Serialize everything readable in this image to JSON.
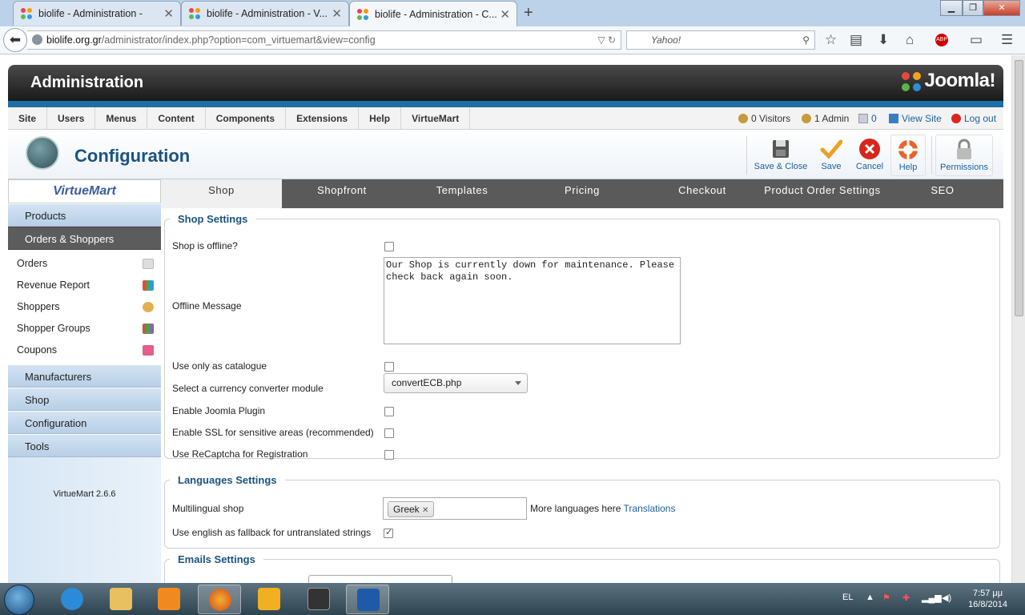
{
  "browser": {
    "tabs": [
      {
        "title": "biolife - Administration -"
      },
      {
        "title": "biolife - Administration - V..."
      },
      {
        "title": "biolife - Administration - C..."
      }
    ],
    "url_host": "biolife.org.gr",
    "url_path": "/administrator/index.php?option=com_virtuemart&view=config",
    "search_placeholder": "Yahoo!",
    "new_tab": "+",
    "close_glyph": "✕"
  },
  "header": {
    "title": "Administration",
    "brand": "Joomla!"
  },
  "menu": {
    "items": [
      "Site",
      "Users",
      "Menus",
      "Content",
      "Components",
      "Extensions",
      "Help",
      "VirtueMart"
    ]
  },
  "status": {
    "visitors": "0 Visitors",
    "admins": "1 Admin",
    "messages": "0",
    "view_site": "View Site",
    "logout": "Log out"
  },
  "toolbar": {
    "title": "Configuration",
    "save_close": "Save & Close",
    "save": "Save",
    "cancel": "Cancel",
    "help": "Help",
    "permissions": "Permissions"
  },
  "sidebar": {
    "logo": "VirtueMart",
    "products": "Products",
    "orders_shoppers": "Orders & Shoppers",
    "sub_items": [
      "Orders",
      "Revenue Report",
      "Shoppers",
      "Shopper Groups",
      "Coupons"
    ],
    "manufacturers": "Manufacturers",
    "shop": "Shop",
    "configuration": "Configuration",
    "tools": "Tools",
    "version": "VirtueMart 2.6.6"
  },
  "tabs": [
    "Shop",
    "Shopfront",
    "Templates",
    "Pricing",
    "Checkout",
    "Product Order Settings",
    "SEO"
  ],
  "shop_settings": {
    "legend": "Shop Settings",
    "offline_label": "Shop is offline?",
    "offline_message_label": "Offline Message",
    "offline_message": "Our Shop is currently down for maintenance. Please check back again soon.",
    "catalogue_label": "Use only as catalogue",
    "currency_label": "Select a currency converter module",
    "currency_value": "convertECB.php",
    "joomla_plugin_label": "Enable Joomla Plugin",
    "ssl_label": "Enable SSL for sensitive areas (recommended)",
    "recaptcha_label": "Use ReCaptcha for Registration"
  },
  "languages": {
    "legend": "Languages Settings",
    "multilingual_label": "Multilingual shop",
    "selected_language": "Greek",
    "chip_remove": "✕",
    "more_text": "More languages here",
    "translations_link": "Translations",
    "fallback_label": "Use english as fallback for untranslated strings"
  },
  "emails": {
    "legend": "Emails Settings"
  },
  "taskbar": {
    "lang": "EL",
    "time": "7:57 μμ",
    "date": "16/8/2014"
  },
  "colors": {
    "accent_blue": "#1a5380",
    "joomla_bar": "#1f6ea5",
    "tab_dark": "#5a5a5a"
  }
}
